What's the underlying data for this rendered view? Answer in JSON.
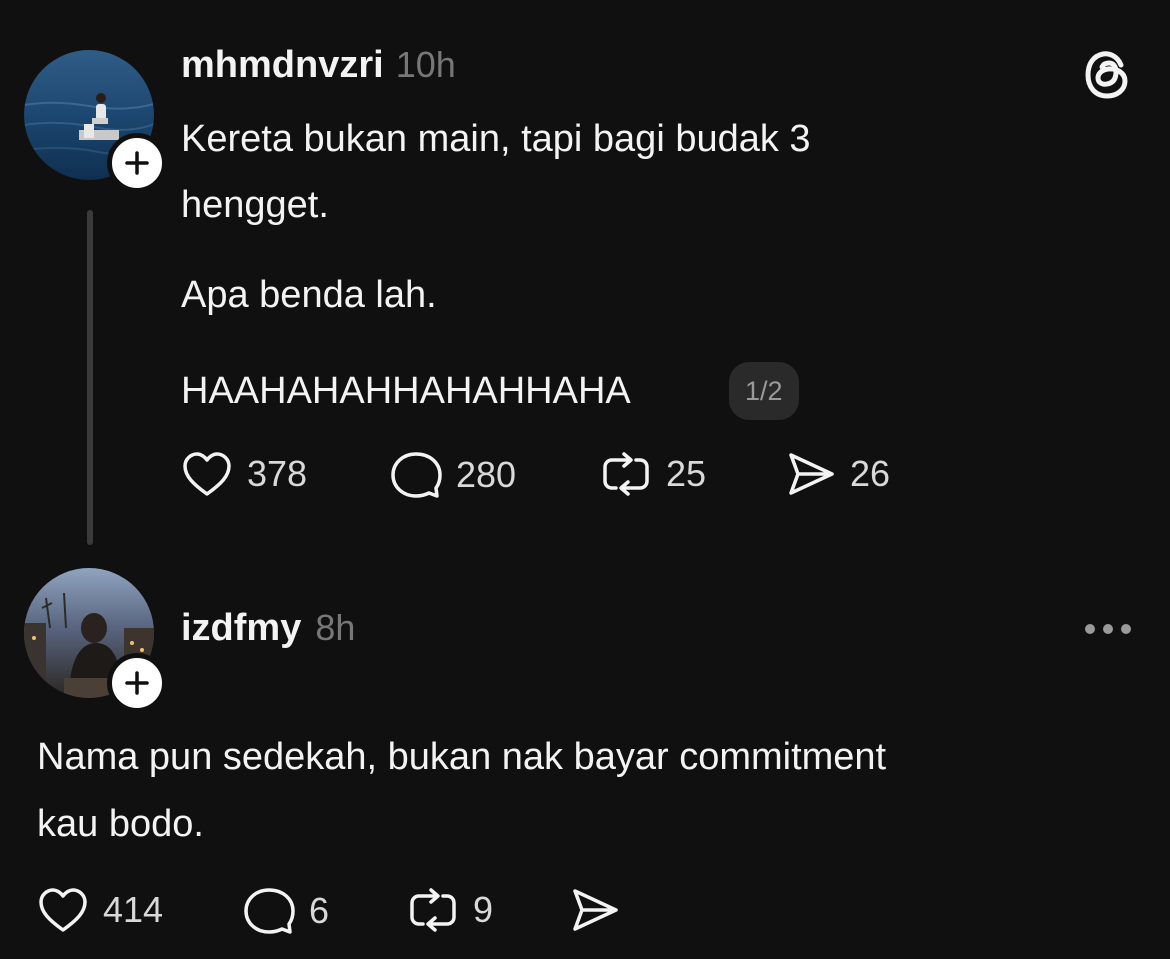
{
  "colors": {
    "background": "#101010",
    "text": "#f3f3f3",
    "muted": "#777777",
    "thread_line": "#3a3a3a"
  },
  "post": {
    "username": "mhmdnvzri",
    "time": "10h",
    "text_lines": [
      "Kereta bukan main, tapi bagi budak 3",
      "hengget.",
      "Apa benda lah.",
      "HAAHAHAHHAHAHHAHA"
    ],
    "page_counter": "1/2",
    "actions": {
      "likes": "378",
      "replies": "280",
      "reposts": "25",
      "shares": "26"
    },
    "app_icon": "threads-logo-icon"
  },
  "reply": {
    "username": "izdfmy",
    "time": "8h",
    "text_lines": [
      "Nama pun sedekah, bukan nak bayar commitment",
      "kau bodo."
    ],
    "actions": {
      "likes": "414",
      "replies": "6",
      "reposts": "9"
    },
    "menu_icon": "more-options-icon"
  }
}
